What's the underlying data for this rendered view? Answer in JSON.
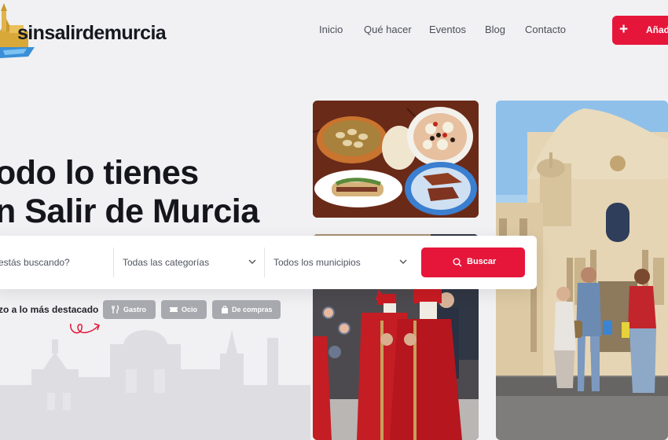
{
  "header": {
    "logo_text": "sinsalirdemurcia",
    "nav": [
      {
        "label": "Inicio"
      },
      {
        "label": "Qué hacer"
      },
      {
        "label": "Eventos"
      },
      {
        "label": "Blog"
      },
      {
        "label": "Contacto"
      }
    ],
    "add_button_label": "Añadi"
  },
  "hero": {
    "title_line1": "odo lo tienes",
    "title_line2": "n Salir de Murcia"
  },
  "search": {
    "keyword_placeholder": "estás buscando?",
    "category_value": "Todas las categorías",
    "municipality_value": "Todos los municipios",
    "button_label": "Buscar"
  },
  "quick": {
    "label": "zo a lo más destacado",
    "chips": [
      {
        "label": "Gastro",
        "icon": "utensils-icon"
      },
      {
        "label": "Ocio",
        "icon": "ticket-icon"
      },
      {
        "label": "De compras",
        "icon": "shopping-bag-icon"
      }
    ]
  },
  "colors": {
    "accent": "#e5163a",
    "chip_bg": "#a7a9ae",
    "page_bg": "#f1f1f3"
  }
}
